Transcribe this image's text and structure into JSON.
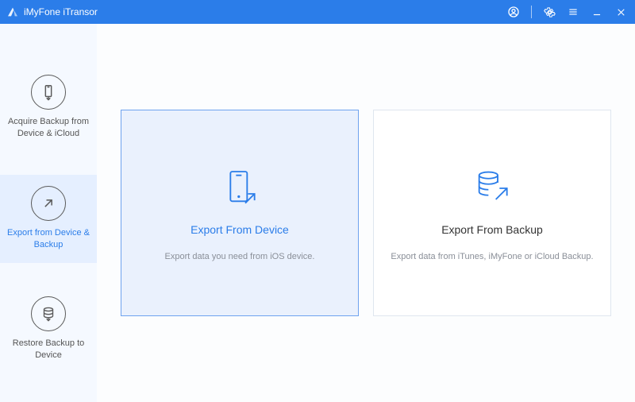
{
  "app": {
    "title": "iMyFone iTransor"
  },
  "sidebar": {
    "items": [
      {
        "label": "Acquire Backup from Device & iCloud"
      },
      {
        "label": "Export from Device & Backup"
      },
      {
        "label": "Restore Backup to Device"
      }
    ],
    "active_index": 1
  },
  "cards": [
    {
      "title": "Export From Device",
      "desc": "Export data you need from iOS device."
    },
    {
      "title": "Export From Backup",
      "desc": "Export data from iTunes, iMyFone or iCloud Backup."
    }
  ],
  "colors": {
    "accent": "#2b7de9"
  }
}
